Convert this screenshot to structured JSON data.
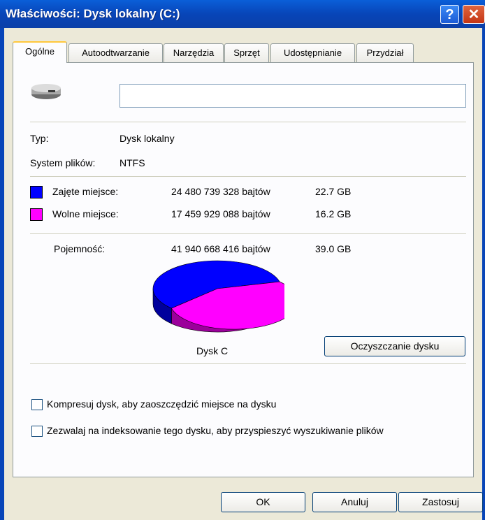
{
  "window": {
    "title": "Właściwości: Dysk lokalny (C:)",
    "help_glyph": "?",
    "close_glyph": "✕"
  },
  "tabs": [
    {
      "label": "Ogólne",
      "active": true
    },
    {
      "label": "Autoodtwarzanie",
      "active": false
    },
    {
      "label": "Narzędzia",
      "active": false
    },
    {
      "label": "Sprzęt",
      "active": false
    },
    {
      "label": "Udostępnianie",
      "active": false
    },
    {
      "label": "Przydział",
      "active": false
    }
  ],
  "general": {
    "volume_label_value": "",
    "type_label": "Typ:",
    "type_value": "Dysk lokalny",
    "fs_label": "System plików:",
    "fs_value": "NTFS",
    "used": {
      "label": "Zajęte miejsce:",
      "bytes": "24 480 739 328 bajtów",
      "size": "22.7 GB",
      "color": "#0000ff"
    },
    "free": {
      "label": "Wolne miejsce:",
      "bytes": "17 459 929 088 bajtów",
      "size": "16.2 GB",
      "color": "#ff00ff"
    },
    "capacity": {
      "label": "Pojemność:",
      "bytes": "41 940 668 416 bajtów",
      "size": "39.0 GB"
    },
    "pie_used_fraction": 0.5837,
    "drive_caption": "Dysk C",
    "cleanup_button": "Oczyszczanie dysku",
    "compress_checkbox": {
      "label": "Kompresuj dysk, aby zaoszczędzić miejsce na dysku",
      "checked": false
    },
    "index_checkbox": {
      "label": "Zezwalaj na indeksowanie tego dysku, aby przyspieszyć wyszukiwanie plików",
      "checked": false
    }
  },
  "buttons": {
    "ok": "OK",
    "cancel": "Anuluj",
    "apply": "Zastosuj"
  }
}
